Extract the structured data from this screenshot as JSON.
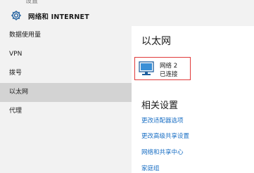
{
  "window": {
    "back_glyph": "←",
    "breadcrumb": "设置"
  },
  "header": {
    "icon": "gear-icon",
    "title": "网络和 INTERNET"
  },
  "sidebar": {
    "items": [
      {
        "label": "数据使用量",
        "active": false
      },
      {
        "label": "VPN",
        "active": false
      },
      {
        "label": "拨号",
        "active": false
      },
      {
        "label": "以太网",
        "active": true
      },
      {
        "label": "代理",
        "active": false
      }
    ]
  },
  "main": {
    "title": "以太网",
    "network": {
      "icon": "monitor-network-icon",
      "name": "网络  2",
      "status": "已连接"
    },
    "related": {
      "title": "相关设置",
      "links": [
        "更改适配器选项",
        "更改高级共享设置",
        "网络和共享中心",
        "家庭组"
      ]
    }
  },
  "colors": {
    "sidebar_bg": "#f2f2f2",
    "active_item_bg": "#d3d3d3",
    "link": "#1a6fc4",
    "selection_border": "#e03a3a"
  }
}
